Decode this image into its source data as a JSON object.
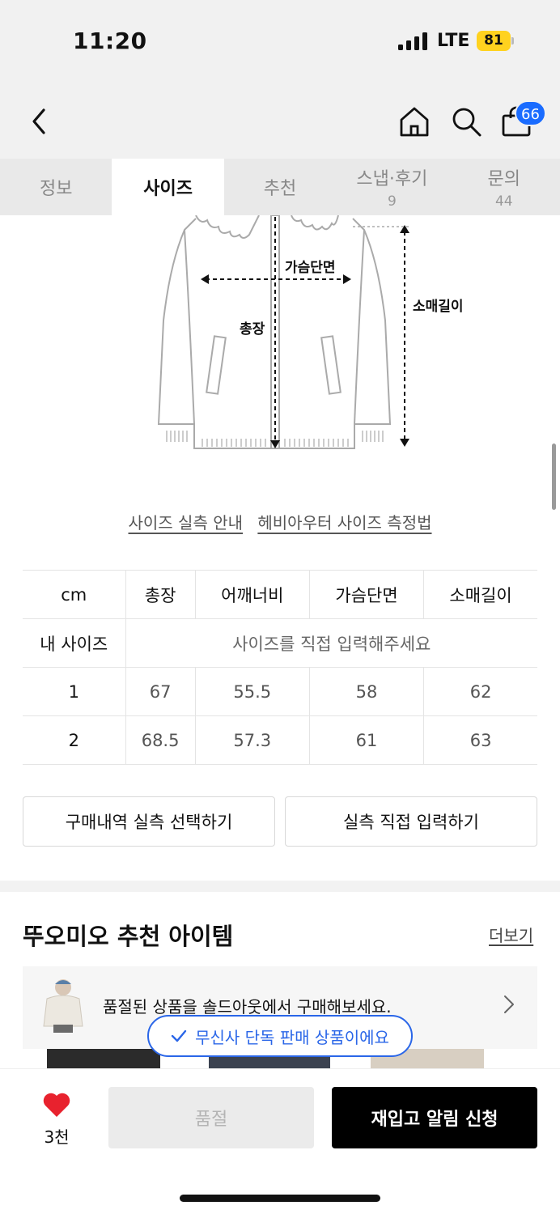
{
  "status_bar": {
    "time": "11:20",
    "network": "LTE",
    "battery": "81"
  },
  "nav": {
    "cart_count": "66"
  },
  "tabs": [
    {
      "label": "정보",
      "count": ""
    },
    {
      "label": "사이즈",
      "count": ""
    },
    {
      "label": "추천",
      "count": ""
    },
    {
      "label": "스냅·후기",
      "count": "9"
    },
    {
      "label": "문의",
      "count": "44"
    }
  ],
  "diagram": {
    "chest": "가슴단면",
    "length": "총장",
    "sleeve": "소매길이"
  },
  "guide": {
    "size_guide": "사이즈 실측 안내",
    "measure_method": "헤비아우터 사이즈 측정법"
  },
  "size_table": {
    "headers": [
      "cm",
      "총장",
      "어깨너비",
      "가슴단면",
      "소매길이"
    ],
    "my_size_label": "내 사이즈",
    "my_size_hint": "사이즈를 직접 입력해주세요",
    "rows": [
      [
        "1",
        "67",
        "55.5",
        "58",
        "62"
      ],
      [
        "2",
        "68.5",
        "57.3",
        "61",
        "63"
      ]
    ]
  },
  "buttons": {
    "select_purchase": "구매내역 실측 선택하기",
    "manual_input": "실측 직접 입력하기"
  },
  "recommend": {
    "title": "뚜오미오 추천 아이템",
    "more": "더보기",
    "soldout_message": "품절된 상품을 솔드아웃에서 구매해보세요."
  },
  "exclusive_badge": "무신사 단독 판매 상품이에요",
  "bottom": {
    "likes": "3천",
    "soldout": "품절",
    "restock": "재입고 알림 신청"
  },
  "colors": {
    "accent_blue": "#2a66e8",
    "badge_blue": "#1a6cff",
    "heart_red": "#e8222e",
    "battery_yellow": "#ffd21f"
  }
}
